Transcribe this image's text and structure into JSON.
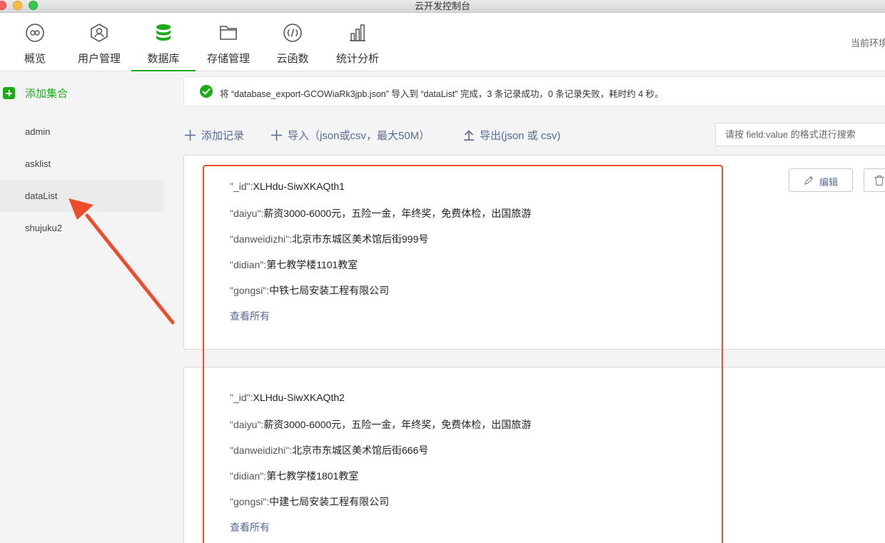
{
  "window": {
    "title": "云开发控制台"
  },
  "nav": {
    "items": [
      {
        "label": "概览",
        "icon": "overview-icon"
      },
      {
        "label": "用户管理",
        "icon": "user-icon"
      },
      {
        "label": "数据库",
        "icon": "database-icon"
      },
      {
        "label": "存储管理",
        "icon": "folder-icon"
      },
      {
        "label": "云函数",
        "icon": "function-icon"
      },
      {
        "label": "统计分析",
        "icon": "stats-icon"
      }
    ],
    "active": "数据库",
    "env_label": "当前环境"
  },
  "colors": {
    "accent": "#1aad19",
    "link": "#576b95",
    "annotation": "#ee4d2d"
  },
  "sidebar": {
    "add_label": "添加集合",
    "collections": [
      "admin",
      "asklist",
      "dataList",
      "shujuku2"
    ],
    "active": "dataList"
  },
  "notice": {
    "text": "将 “database_export-GCOWiaRk3jpb.json” 导入到 “dataList” 完成，3 条记录成功，0 条记录失败，耗时约 4 秒。"
  },
  "actions": {
    "add_record": "添加记录",
    "import": "导入（json或csv，最大50M）",
    "export": "导出(json 或 csv)",
    "search_placeholder": "请按 field:value 的格式进行搜索"
  },
  "records": [
    {
      "fields": [
        {
          "key": "\"_id\":",
          "value": "XLHdu-SiwXKAQth1"
        },
        {
          "key": "\"daiyu\":",
          "value": "薪资3000-6000元，五险一金，年终奖，免费体检，出国旅游"
        },
        {
          "key": "\"danweidizhi\":",
          "value": "北京市东城区美术馆后街999号"
        },
        {
          "key": "\"didian\":",
          "value": "第七教学楼1101教室"
        },
        {
          "key": "\"gongsi\":",
          "value": "中铁七局安装工程有限公司"
        }
      ],
      "view_all": "查看所有",
      "edit_label": "编辑"
    },
    {
      "fields": [
        {
          "key": "\"_id\":",
          "value": "XLHdu-SiwXKAQth2"
        },
        {
          "key": "\"daiyu\":",
          "value": "薪资3000-6000元，五险一金，年终奖，免费体检，出国旅游"
        },
        {
          "key": "\"danweidizhi\":",
          "value": "北京市东城区美术馆后街666号"
        },
        {
          "key": "\"didian\":",
          "value": "第七教学楼1801教室"
        },
        {
          "key": "\"gongsi\":",
          "value": "中建七局安装工程有限公司"
        }
      ],
      "view_all": "查看所有"
    }
  ]
}
